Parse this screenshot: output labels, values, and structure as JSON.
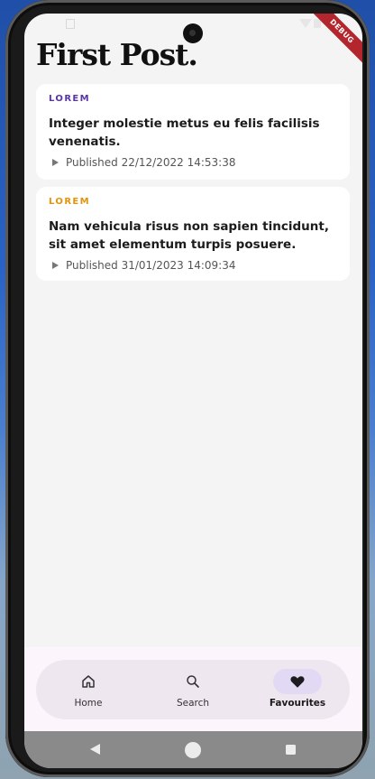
{
  "app": {
    "title": "First Post.",
    "debug_banner": "DEBUG"
  },
  "posts": [
    {
      "category": "LOREM",
      "category_color": "#5a34a8",
      "title": "Integer molestie metus eu felis facilisis venenatis.",
      "published": "Published 22/12/2022 14:53:38"
    },
    {
      "category": "LOREM",
      "category_color": "#e3940a",
      "title": "Nam vehicula risus non sapien tincidunt, sit amet elementum turpis posuere.",
      "published": "Published 31/01/2023 14:09:34"
    }
  ],
  "nav": {
    "items": [
      {
        "label": "Home",
        "icon": "home-icon"
      },
      {
        "label": "Search",
        "icon": "search-icon"
      },
      {
        "label": "Favourites",
        "icon": "heart-icon",
        "selected": true
      }
    ]
  },
  "colors": {
    "accent_selected": "#e2daf4",
    "screen_background": "#f4f4f4"
  }
}
